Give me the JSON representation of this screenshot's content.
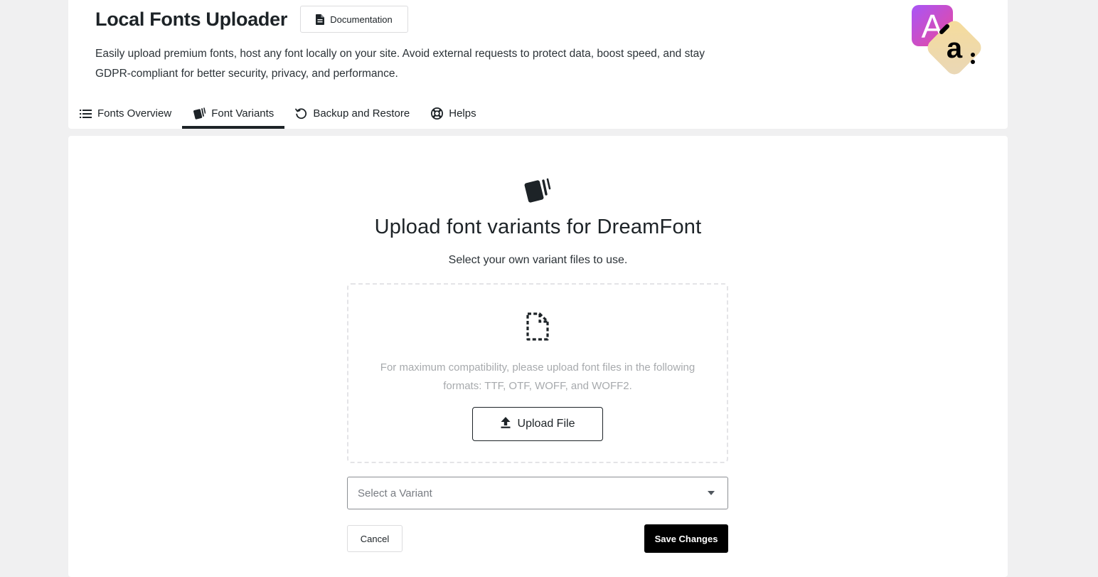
{
  "header": {
    "title": "Local Fonts Uploader",
    "documentation_label": "Documentation",
    "description_line1": "Easily upload premium fonts, host any font locally on your site. Avoid external requests to protect data, boost speed, and stay",
    "description_line2": "GDPR-compliant for better security, privacy, and performance.",
    "logo_letters": [
      "A",
      "a"
    ]
  },
  "tabs": [
    {
      "label": "Fonts Overview",
      "icon": "list-icon",
      "active": false
    },
    {
      "label": "Font Variants",
      "icon": "cards-icon",
      "active": true
    },
    {
      "label": "Backup and Restore",
      "icon": "restore-icon",
      "active": false
    },
    {
      "label": "Helps",
      "icon": "lifebuoy-icon",
      "active": false
    }
  ],
  "main": {
    "heading": "Upload font variants for DreamFont",
    "subtitle": "Select your own variant files to use.",
    "dropzone": {
      "hint_line1": "For maximum compatibility, please upload font files in the following",
      "hint_line2": "formats: TTF, OTF, WOFF, and WOFF2.",
      "upload_label": "Upload File"
    },
    "variant_select": {
      "placeholder": "Select a Variant"
    },
    "cancel_label": "Cancel",
    "save_label": "Save Changes"
  },
  "colors": {
    "page_background": "#f0f0f1",
    "card_background": "#ffffff",
    "primary_text": "#1d2327",
    "muted_text": "#a7aaad",
    "save_button": "#000000",
    "logo_gradient_start": "#a855f7",
    "logo_gradient_end": "#ec4899",
    "logo_tile": "#f3d28b"
  }
}
